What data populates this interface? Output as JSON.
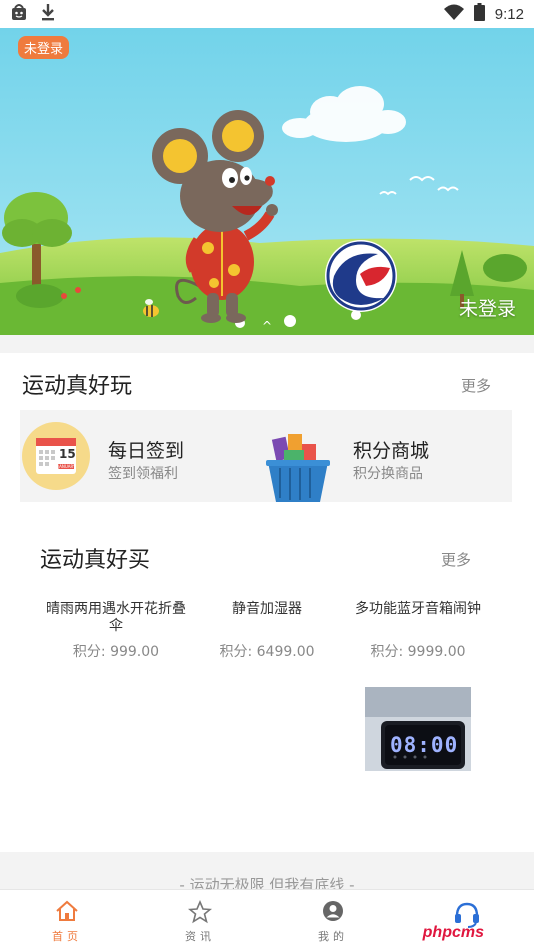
{
  "status_bar": {
    "time": "9:12"
  },
  "banner": {
    "badge": "未登录",
    "login_text": "未登录",
    "indicator": "^"
  },
  "section_play": {
    "title": "运动真好玩",
    "more": "更多",
    "cards": [
      {
        "title": "每日签到",
        "subtitle": "签到领福利",
        "icon_date": "15",
        "icon_month": "JANUARY"
      },
      {
        "title": "积分商城",
        "subtitle": "积分换商品"
      }
    ]
  },
  "section_buy": {
    "title": "运动真好买",
    "more": "更多",
    "products": [
      {
        "name": "晴雨两用遇水开花折叠伞",
        "points": "积分: 999.00"
      },
      {
        "name": "静音加湿器",
        "points": "积分: 6499.00"
      },
      {
        "name": "多功能蓝牙音箱闹钟",
        "points": "积分: 9999.00",
        "image_text": "08:00"
      }
    ]
  },
  "slogan": "- 运动无极限 但我有底线 -",
  "tabs": [
    {
      "label": "首页",
      "icon": "home-icon",
      "active": true
    },
    {
      "label": "资讯",
      "icon": "star-icon",
      "active": false
    },
    {
      "label": "我的",
      "icon": "user-icon",
      "active": false
    },
    {
      "label": "",
      "icon": "headset-icon",
      "active": false
    }
  ],
  "watermark": "phpcms",
  "colors": {
    "accent": "#ef7b3e",
    "sky": "#7fd6ec",
    "grass": "#8ccb3c"
  }
}
